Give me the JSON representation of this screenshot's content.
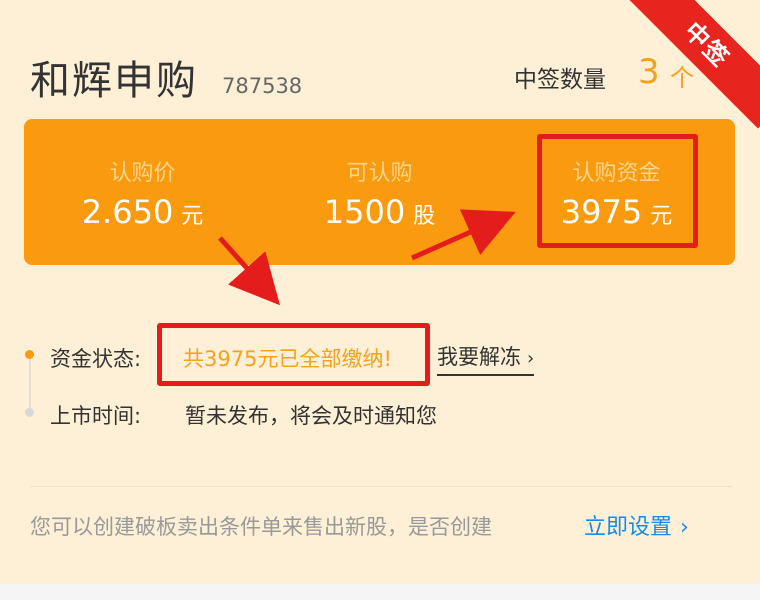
{
  "header": {
    "title": "和辉申购",
    "code": "787538",
    "lot_label": "中签数量",
    "lot_value": "3",
    "lot_unit": "个",
    "ribbon": "中签"
  },
  "summary": [
    {
      "label": "认购价",
      "value": "2.650",
      "unit": "元"
    },
    {
      "label": "可认购",
      "value": "1500",
      "unit": "股"
    },
    {
      "label": "认购资金",
      "value": "3975",
      "unit": "元"
    }
  ],
  "status": {
    "fund_label": "资金状态:",
    "fund_value": "共3975元已全部缴纳!",
    "unfreeze_link": "我要解冻",
    "unfreeze_chevron": "›",
    "listing_label": "上市时间:",
    "listing_value": "暂未发布，将会及时通知您"
  },
  "footer": {
    "hint": "您可以创建破板卖出条件单来售出新股，是否创建",
    "setup_link": "立即设置",
    "setup_chevron": "›"
  },
  "colors": {
    "accent": "#f99a0f",
    "highlight": "#e51c1c",
    "link": "#1a8ae6",
    "ribbon": "#e8241f"
  }
}
